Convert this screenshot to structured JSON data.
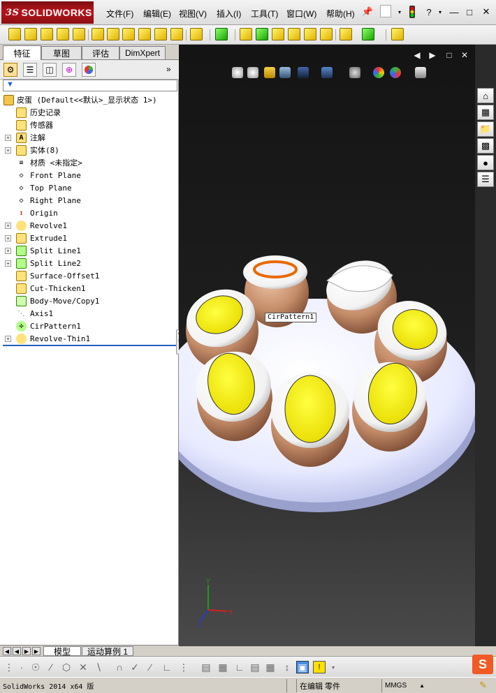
{
  "app": {
    "logo_prefix": "3S",
    "logo_text": "SOLIDWORKS"
  },
  "menu": [
    {
      "label": "文件(F)"
    },
    {
      "label": "编辑(E)"
    },
    {
      "label": "视图(V)"
    },
    {
      "label": "插入(I)"
    },
    {
      "label": "工具(T)"
    },
    {
      "label": "窗口(W)"
    },
    {
      "label": "帮助(H)"
    }
  ],
  "manager_tabs": [
    {
      "label": "特征",
      "active": true
    },
    {
      "label": "草图",
      "active": false
    },
    {
      "label": "评估",
      "active": false
    },
    {
      "label": "DimXpert",
      "active": false
    }
  ],
  "tree": {
    "root": {
      "label": "皮蛋  (Default<<默认>_显示状态 1>)",
      "icon": "part-icon"
    },
    "items": [
      {
        "label": "历史记录",
        "icon": "history-icon",
        "expander": ""
      },
      {
        "label": "传感器",
        "icon": "sensor-icon",
        "expander": ""
      },
      {
        "label": "注解",
        "icon": "annotation-icon",
        "expander": "+"
      },
      {
        "label": "实体(8)",
        "icon": "solid-bodies-icon",
        "expander": "+"
      },
      {
        "label": "材质 <未指定>",
        "icon": "material-icon",
        "expander": ""
      },
      {
        "label": "Front Plane",
        "icon": "plane-icon",
        "expander": ""
      },
      {
        "label": "Top Plane",
        "icon": "plane-icon",
        "expander": ""
      },
      {
        "label": "Right Plane",
        "icon": "plane-icon",
        "expander": ""
      },
      {
        "label": "Origin",
        "icon": "origin-icon",
        "expander": ""
      },
      {
        "label": "Revolve1",
        "icon": "revolve-icon",
        "expander": "+"
      },
      {
        "label": "Extrude1",
        "icon": "extrude-icon",
        "expander": "+"
      },
      {
        "label": "Split Line1",
        "icon": "split-line-icon",
        "expander": "+"
      },
      {
        "label": "Split Line2",
        "icon": "split-line-icon",
        "expander": "+"
      },
      {
        "label": "Surface-Offset1",
        "icon": "surface-offset-icon",
        "expander": ""
      },
      {
        "label": "Cut-Thicken1",
        "icon": "cut-thicken-icon",
        "expander": ""
      },
      {
        "label": "Body-Move/Copy1",
        "icon": "move-copy-icon",
        "expander": ""
      },
      {
        "label": "Axis1",
        "icon": "axis-icon",
        "expander": ""
      },
      {
        "label": "CirPattern1",
        "icon": "circular-pattern-icon",
        "expander": ""
      },
      {
        "label": "Revolve-Thin1",
        "icon": "revolve-thin-icon",
        "expander": "+"
      }
    ]
  },
  "viewport": {
    "tooltip": "CirPattern1",
    "triad": {
      "x_label": "X",
      "y_label": "Y",
      "z_label": "Z"
    },
    "colors": {
      "plate": "#eef0ff",
      "yolk": "#f4ee00",
      "white": "#ffffff",
      "shell": "#c08060",
      "rim": "#e87000"
    }
  },
  "bottom_tabs": [
    {
      "label": "模型",
      "active": true
    },
    {
      "label": "运动算例 1",
      "active": false
    }
  ],
  "status": {
    "version": "SolidWorks 2014 x64 版",
    "mode": "在编辑 零件",
    "units": "MMGS"
  },
  "ime": {
    "label": "S"
  }
}
